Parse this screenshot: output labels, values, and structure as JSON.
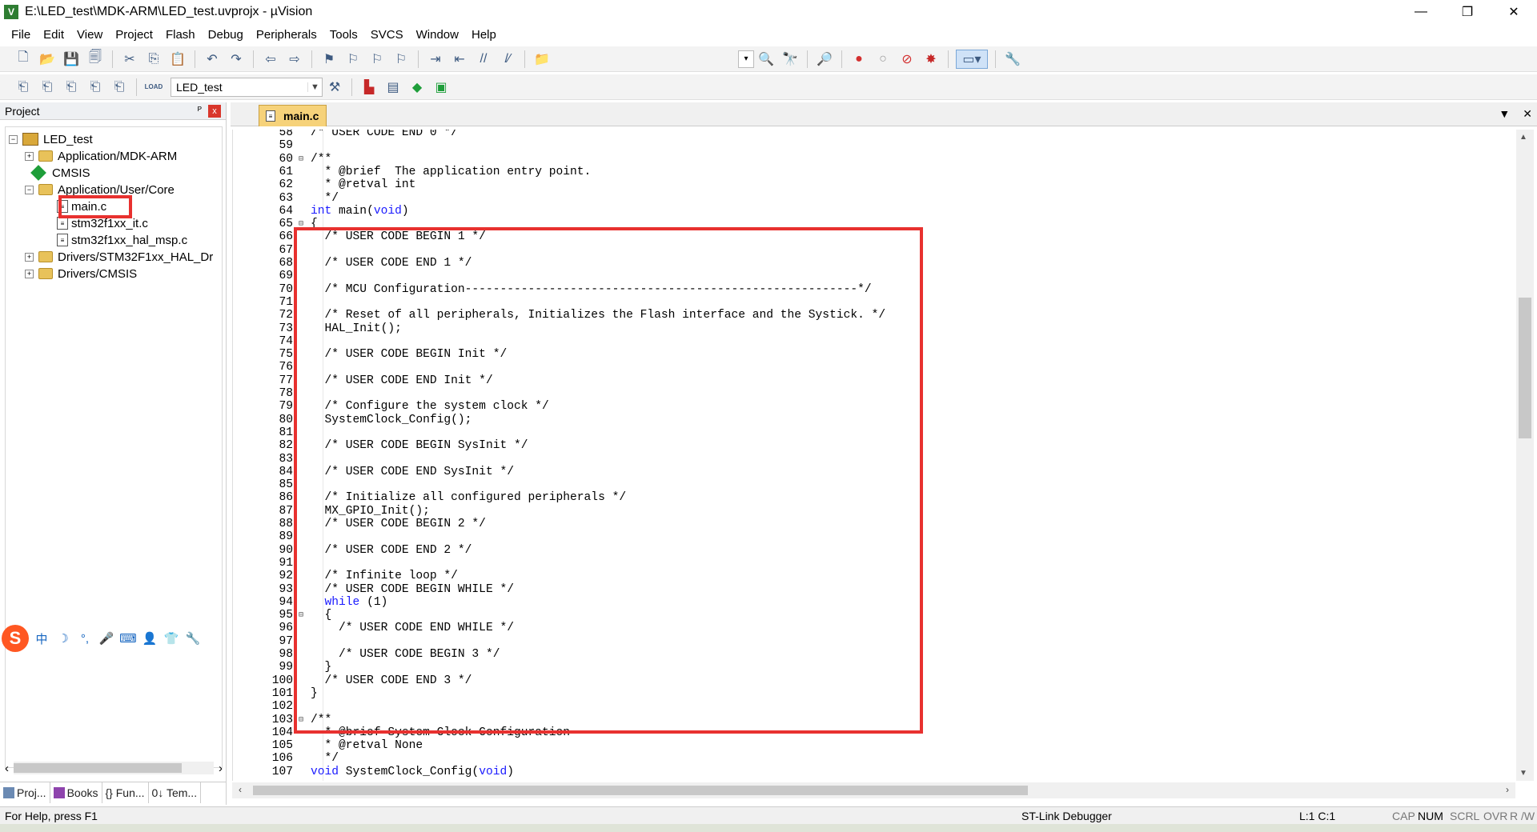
{
  "titlebar": {
    "title": "E:\\LED_test\\MDK-ARM\\LED_test.uvprojx - µVision",
    "app_icon": "V",
    "minimize": "—",
    "restore": "❐",
    "close": "✕"
  },
  "menu": [
    "File",
    "Edit",
    "View",
    "Project",
    "Flash",
    "Debug",
    "Peripherals",
    "Tools",
    "SVCS",
    "Window",
    "Help"
  ],
  "toolbar2": {
    "load_label": "LOAD",
    "target": "LED_test"
  },
  "project": {
    "header": "Project",
    "pin": "ᴾ",
    "close": "x",
    "tree": {
      "root": "LED_test",
      "app_mdk": "Application/MDK-ARM",
      "cmsis": "CMSIS",
      "app_user": "Application/User/Core",
      "main_c": "main.c",
      "it_c": "stm32f1xx_it.c",
      "msp_c": "stm32f1xx_hal_msp.c",
      "drivers_hal": "Drivers/STM32F1xx_HAL_Dr",
      "drivers_cmsis": "Drivers/CMSIS"
    },
    "ime": {
      "logo": "S",
      "chinese": "中"
    },
    "tabs": [
      "Proj...",
      "Books",
      "{} Fun...",
      "0↓ Tem..."
    ]
  },
  "editor": {
    "tab": "main.c",
    "lines": [
      {
        "n": "58",
        "t": "/* USER CODE END 0 */"
      },
      {
        "n": "59",
        "t": ""
      },
      {
        "n": "60",
        "t": "/**",
        "fold": "⊟"
      },
      {
        "n": "61",
        "t": "  * @brief  The application entry point."
      },
      {
        "n": "62",
        "t": "  * @retval int"
      },
      {
        "n": "63",
        "t": "  */"
      },
      {
        "n": "64",
        "t": "int main(void)",
        "kw": true
      },
      {
        "n": "65",
        "t": "{",
        "fold": "⊟"
      },
      {
        "n": "66",
        "t": "  /* USER CODE BEGIN 1 */"
      },
      {
        "n": "67",
        "t": ""
      },
      {
        "n": "68",
        "t": "  /* USER CODE END 1 */"
      },
      {
        "n": "69",
        "t": ""
      },
      {
        "n": "70",
        "t": "  /* MCU Configuration--------------------------------------------------------*/"
      },
      {
        "n": "71",
        "t": ""
      },
      {
        "n": "72",
        "t": "  /* Reset of all peripherals, Initializes the Flash interface and the Systick. */"
      },
      {
        "n": "73",
        "t": "  HAL_Init();"
      },
      {
        "n": "74",
        "t": ""
      },
      {
        "n": "75",
        "t": "  /* USER CODE BEGIN Init */"
      },
      {
        "n": "76",
        "t": ""
      },
      {
        "n": "77",
        "t": "  /* USER CODE END Init */"
      },
      {
        "n": "78",
        "t": ""
      },
      {
        "n": "79",
        "t": "  /* Configure the system clock */"
      },
      {
        "n": "80",
        "t": "  SystemClock_Config();"
      },
      {
        "n": "81",
        "t": ""
      },
      {
        "n": "82",
        "t": "  /* USER CODE BEGIN SysInit */"
      },
      {
        "n": "83",
        "t": ""
      },
      {
        "n": "84",
        "t": "  /* USER CODE END SysInit */"
      },
      {
        "n": "85",
        "t": ""
      },
      {
        "n": "86",
        "t": "  /* Initialize all configured peripherals */"
      },
      {
        "n": "87",
        "t": "  MX_GPIO_Init();"
      },
      {
        "n": "88",
        "t": "  /* USER CODE BEGIN 2 */"
      },
      {
        "n": "89",
        "t": ""
      },
      {
        "n": "90",
        "t": "  /* USER CODE END 2 */"
      },
      {
        "n": "91",
        "t": ""
      },
      {
        "n": "92",
        "t": "  /* Infinite loop */"
      },
      {
        "n": "93",
        "t": "  /* USER CODE BEGIN WHILE */"
      },
      {
        "n": "94",
        "t": "  while (1)",
        "kw": true
      },
      {
        "n": "95",
        "t": "  {",
        "fold": "⊟"
      },
      {
        "n": "96",
        "t": "    /* USER CODE END WHILE */"
      },
      {
        "n": "97",
        "t": ""
      },
      {
        "n": "98",
        "t": "    /* USER CODE BEGIN 3 */"
      },
      {
        "n": "99",
        "t": "  }"
      },
      {
        "n": "100",
        "t": "  /* USER CODE END 3 */"
      },
      {
        "n": "101",
        "t": "}"
      },
      {
        "n": "102",
        "t": ""
      },
      {
        "n": "103",
        "t": "/**",
        "fold": "⊟"
      },
      {
        "n": "104",
        "t": "  * @brief System Clock Configuration"
      },
      {
        "n": "105",
        "t": "  * @retval None"
      },
      {
        "n": "106",
        "t": "  */"
      },
      {
        "n": "107",
        "t": "void SystemClock_Config(void)",
        "kw": true
      }
    ]
  },
  "status": {
    "help": "For Help, press F1",
    "debugger": "ST-Link Debugger",
    "position": "L:1 C:1",
    "cap": "CAP",
    "num": "NUM",
    "scrl": "SCRL",
    "ovr": "OVR",
    "rw": "R /W"
  },
  "colors": {
    "highlight": "#e8312f",
    "keyword": "#1a1aff",
    "tab": "#f6d27a"
  }
}
